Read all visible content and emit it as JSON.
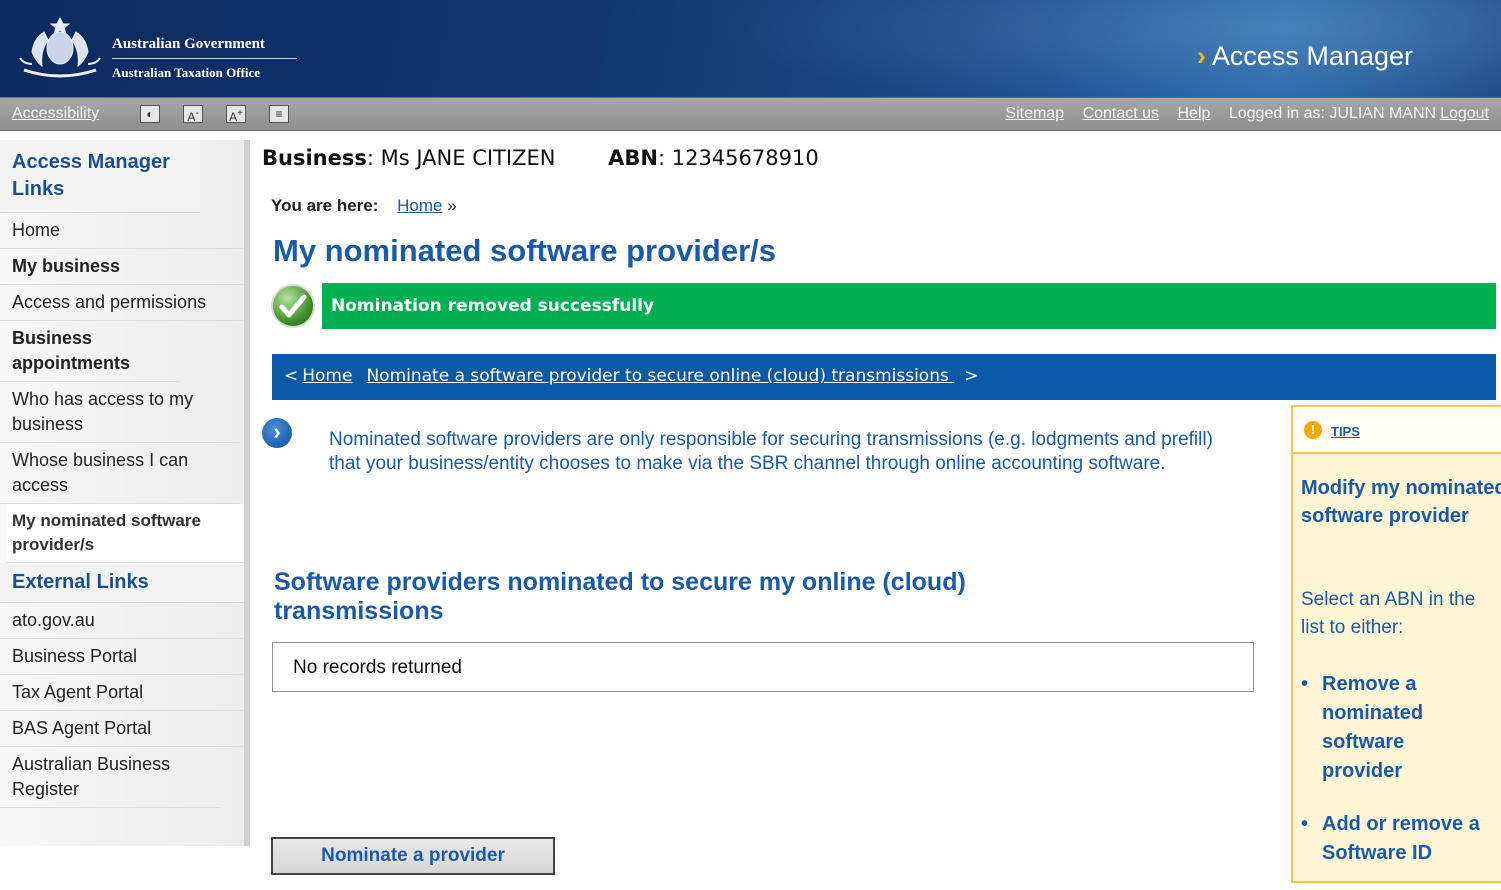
{
  "header": {
    "gov_name": "Australian Government",
    "agency_name": "Australian Taxation Office",
    "app_title": "Access Manager",
    "crest": "coat-of-arms-icon"
  },
  "utility_bar": {
    "accessibility": "Accessibility",
    "buttons": [
      "contrast",
      "A-",
      "A+",
      "text-only"
    ],
    "sitemap": "Sitemap",
    "contact": "Contact us",
    "help": "Help",
    "logged_in": "Logged in as: JULIAN MANN",
    "logout": "Logout"
  },
  "sidebar": {
    "heading": "Access Manager Links",
    "items": [
      {
        "label": "Home",
        "bold": false
      },
      {
        "label": "My business",
        "bold": true
      },
      {
        "label": "Access and permissions",
        "bold": false
      },
      {
        "label": "Business appointments",
        "bold": true
      },
      {
        "label": "Who has access to my business",
        "bold": false
      },
      {
        "label": "Whose business I can access",
        "bold": false
      },
      {
        "label": "My nominated software provider/s",
        "active": true
      }
    ],
    "external_heading": "External Links",
    "external_items": [
      "ato.gov.au",
      "Business Portal",
      "Tax Agent Portal",
      "BAS Agent Portal",
      "Australian Business Register"
    ]
  },
  "business_line": {
    "business_label": "Business",
    "business_value": ": Ms JANE CITIZEN",
    "abn_label": "ABN",
    "abn_value": ": 12345678910"
  },
  "breadcrumb": {
    "label": "You are here:",
    "home": "Home",
    "sep": "»"
  },
  "page_title": "My nominated software provider/s",
  "success_message": "Nomination  removed successfully",
  "nav_bar": {
    "prev": "<",
    "home": "Home",
    "link": "Nominate a  software provider to secure online (cloud) transmissions ",
    "next": ">"
  },
  "info_text": "Nominated software providers are only responsible for securing transmissions (e.g. lodgments and prefill) that your business/entity chooses  to make via the SBR channel through online accounting software.",
  "section_title": "Software providers nominated to secure my online (cloud) transmissions",
  "records_text": "No records returned",
  "nominate_button": "Nominate a provider",
  "tips": {
    "label": "TIPS",
    "title": "Modify my nominated software provider",
    "body": "Select an ABN in the list to either:",
    "items": [
      "Remove a nominated software provider",
      "Add or remove a Software ID"
    ]
  },
  "colors": {
    "header_bg": "#12376f",
    "brand_blue": "#1a5aa8",
    "success_green": "#00b050",
    "nav_blue": "#0b5aa8",
    "tips_border": "#f2c94c"
  }
}
